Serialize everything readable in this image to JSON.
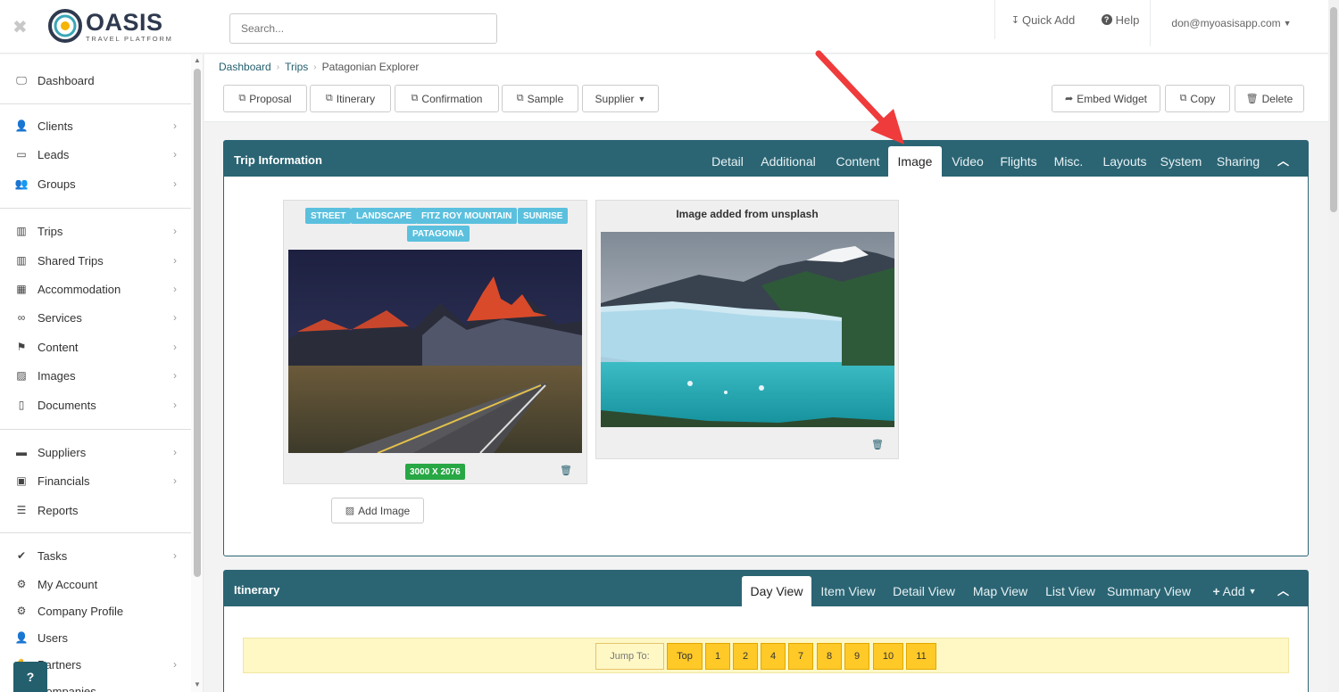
{
  "header": {
    "logo_text": "OASIS",
    "logo_subtitle": "TRAVEL PLATFORM",
    "search_placeholder": "Search...",
    "quick_add": "Quick Add",
    "help": "Help",
    "user_email": "don@myoasisapp.com"
  },
  "sidebar": {
    "items": [
      {
        "label": "Dashboard",
        "icon": "monitor-icon"
      },
      {
        "label": "Clients",
        "icon": "user-icon"
      },
      {
        "label": "Leads",
        "icon": "inbox-icon"
      },
      {
        "label": "Groups",
        "icon": "users-icon"
      },
      {
        "label": "Trips",
        "icon": "suitcase-icon"
      },
      {
        "label": "Shared Trips",
        "icon": "suitcase-icon"
      },
      {
        "label": "Accommodation",
        "icon": "building-icon"
      },
      {
        "label": "Services",
        "icon": "binoculars-icon"
      },
      {
        "label": "Content",
        "icon": "flag-icon"
      },
      {
        "label": "Images",
        "icon": "image-icon"
      },
      {
        "label": "Documents",
        "icon": "pdf-icon"
      },
      {
        "label": "Suppliers",
        "icon": "truck-icon"
      },
      {
        "label": "Financials",
        "icon": "money-icon"
      },
      {
        "label": "Reports",
        "icon": "list-icon"
      },
      {
        "label": "Tasks",
        "icon": "check-icon"
      },
      {
        "label": "My Account",
        "icon": "gear-icon"
      },
      {
        "label": "Company Profile",
        "icon": "gears-icon"
      },
      {
        "label": "Users",
        "icon": "user-icon"
      },
      {
        "label": "Partners",
        "icon": "handshake-icon"
      },
      {
        "label": "Companies",
        "icon": "building-icon"
      }
    ],
    "help_label": "?"
  },
  "breadcrumb": {
    "items": [
      "Dashboard",
      "Trips"
    ],
    "current": "Patagonian Explorer"
  },
  "toolbar": {
    "proposal": "Proposal",
    "itinerary": "Itinerary",
    "confirmation": "Confirmation",
    "sample": "Sample",
    "supplier": "Supplier",
    "embed_widget": "Embed Widget",
    "copy": "Copy",
    "delete": "Delete"
  },
  "trip_info": {
    "title": "Trip Information",
    "tabs": [
      "Detail",
      "Additional",
      "Content",
      "Image",
      "Video",
      "Flights",
      "Misc.",
      "Layouts",
      "System",
      "Sharing"
    ],
    "active_tab": "Image",
    "images": [
      {
        "tags": [
          "STREET",
          "LANDSCAPE",
          "FITZ ROY MOUNTAIN",
          "SUNRISE",
          "PATAGONIA"
        ],
        "dimensions": "3000 X 2076"
      },
      {
        "title": "Image added from unsplash"
      }
    ],
    "add_image": "Add Image"
  },
  "itinerary": {
    "title": "Itinerary",
    "tabs": [
      "Day View",
      "Item View",
      "Detail View",
      "Map View",
      "List View",
      "Summary View"
    ],
    "active_tab": "Day View",
    "add_label": "Add",
    "jump_to": "Jump To:",
    "jump_buttons": [
      "Top",
      "1",
      "2",
      "4",
      "7",
      "8",
      "9",
      "10",
      "11"
    ]
  },
  "colors": {
    "panel_header": "#2b6574",
    "accent": "#245f6e",
    "tag": "#5bc0de",
    "badge_green": "#28a745",
    "jump_yellow": "#ffc928",
    "arrow_red": "#ef3b3b"
  }
}
